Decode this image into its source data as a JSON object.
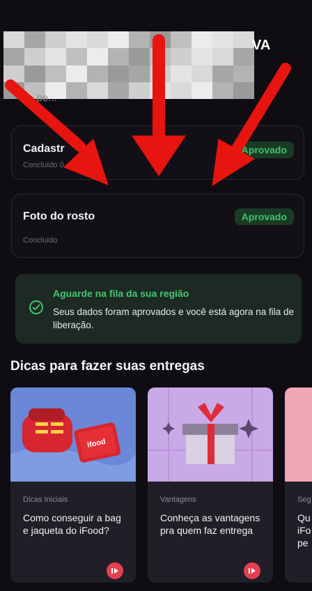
{
  "header": {
    "name_tail": "VA",
    "subtitle_partial": "...pe..."
  },
  "steps": [
    {
      "title": "Cadastr",
      "subtitle": "Concluído 0...26",
      "status": "Aprovado"
    },
    {
      "title": "Foto do rosto",
      "subtitle": "Concluído",
      "status": "Aprovado"
    }
  ],
  "notice": {
    "title": "Aguarde na fila da sua região",
    "text": "Seus dados foram aprovados e você está agora na fila de liberação."
  },
  "tips": {
    "heading": "Dicas para fazer suas entregas",
    "cards": [
      {
        "category": "Dicas Iniciais",
        "title": "Como conseguir a bag e jaqueta do iFood?"
      },
      {
        "category": "Vantagens",
        "title": "Conheça as vantagens pra quem faz entrega"
      },
      {
        "category": "Seg",
        "title": "Qu iFo pe"
      }
    ]
  },
  "colors": {
    "background": "#0f0d12",
    "accent_green": "#3fc46d",
    "brand_red": "#e5404f",
    "annotation_red": "#e8140f"
  },
  "icons": [
    "check-circle-icon",
    "play-icon",
    "red-arrow-annotation"
  ]
}
